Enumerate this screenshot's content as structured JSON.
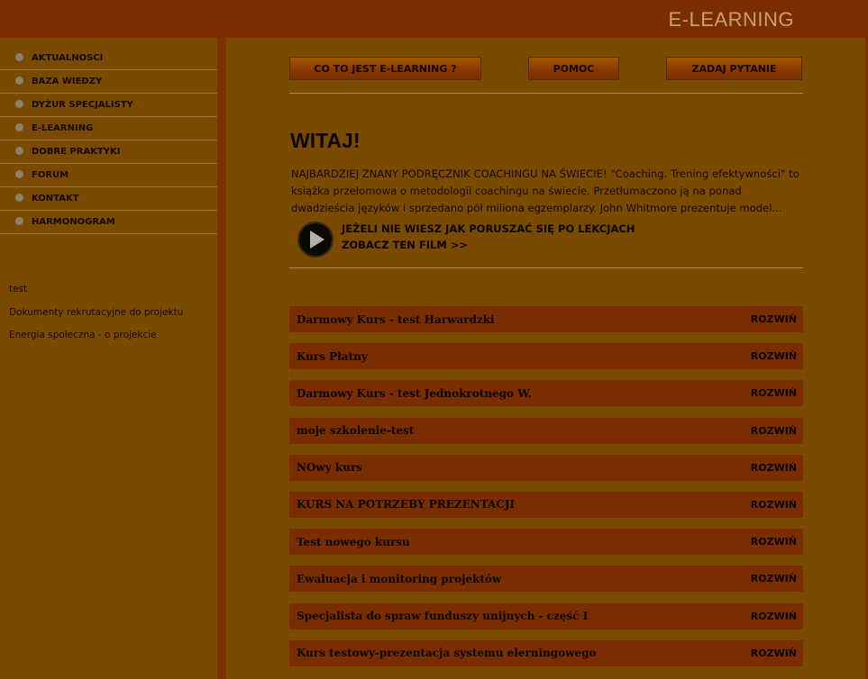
{
  "header": {
    "title": "E-LEARNING"
  },
  "sidebar": {
    "menu": [
      {
        "label": "AKTUALNOSCI"
      },
      {
        "label": "BAZA WIEDZY"
      },
      {
        "label": "DYŻUR SPECJALISTY"
      },
      {
        "label": "E-LEARNING"
      },
      {
        "label": "DOBRE PRAKTYKI"
      },
      {
        "label": "FORUM"
      },
      {
        "label": "KONTAKT"
      },
      {
        "label": "HARMONOGRAM"
      }
    ],
    "links": [
      {
        "label": "test"
      },
      {
        "label": "Dokumenty rekrutacyjne do projektu"
      },
      {
        "label": "Energia społeczna - o projekcie"
      }
    ]
  },
  "topnav": {
    "what_is": "CO TO JEST E-LEARNING ?",
    "help": "POMOC",
    "ask": "ZADAJ PYTANIE"
  },
  "main": {
    "welcome": "WITAJ!",
    "intro": "NAJBARDZIEJ ZNANY PODRĘCZNIK COACHINGU NA ŚWIECIE! \"Coaching. Trening efektywności\" to książka przełomowa o metodologii coachingu na świecie. Przetłumaczono ją na ponad dwadzieścia języków i sprzedano pół miliona egzemplarzy. John Whitmore prezentuje model...",
    "film_line1": "JEŻELI NIE WIESZ JAK PORUSZAĆ SIĘ PO LEKCJACH",
    "film_line2": "ZOBACZ TEN FILM >>",
    "expand_label": "ROZWIŃ",
    "courses": [
      {
        "name": "Darmowy Kurs - test Harwardzki"
      },
      {
        "name": "Kurs Płatny"
      },
      {
        "name": "Darmowy Kurs - test Jednokrotnego W."
      },
      {
        "name": "moje szkolenie-test"
      },
      {
        "name": "NOwy kurs"
      },
      {
        "name": "KURS NA POTRZEBY PREZENTACJI"
      },
      {
        "name": "Test nowego kursu"
      },
      {
        "name": "Ewaluacja i monitoring projektów"
      },
      {
        "name": "Specjalista do spraw funduszy unijnych - część I"
      },
      {
        "name": "Kurs testowy-prezentacja systemu elerningowego"
      }
    ]
  }
}
